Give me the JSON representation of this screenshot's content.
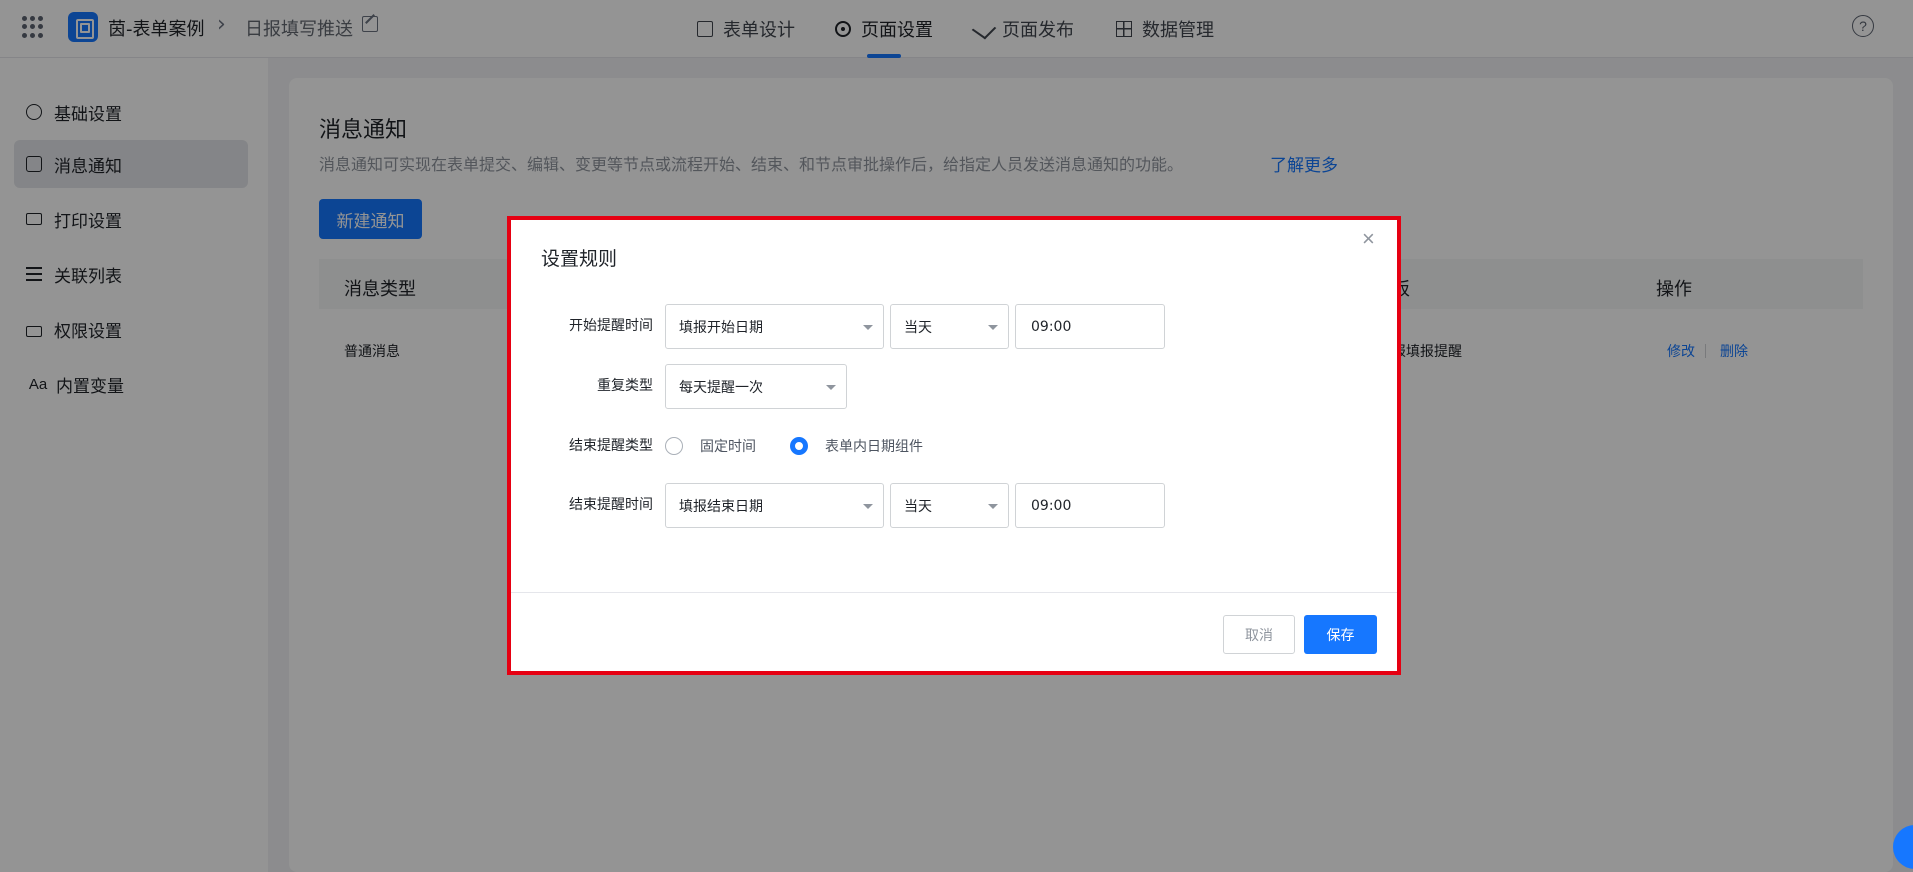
{
  "topbar": {
    "app_name": "茵-表单案例",
    "breadcrumb_sep": "›",
    "page_name": "日报填写推送",
    "tabs": [
      {
        "label": "表单设计",
        "icon": "document-icon",
        "active": false
      },
      {
        "label": "页面设置",
        "icon": "gear-icon",
        "active": true
      },
      {
        "label": "页面发布",
        "icon": "send-icon",
        "active": false
      },
      {
        "label": "数据管理",
        "icon": "grid-icon",
        "active": false
      }
    ],
    "help_glyph": "?"
  },
  "sidebar": {
    "items": [
      {
        "label": "基础设置",
        "icon": "gear-icon",
        "active": false
      },
      {
        "label": "消息通知",
        "icon": "message-icon",
        "active": true
      },
      {
        "label": "打印设置",
        "icon": "printer-icon",
        "active": false
      },
      {
        "label": "关联列表",
        "icon": "list-icon",
        "active": false
      },
      {
        "label": "权限设置",
        "icon": "lock-icon",
        "active": false
      },
      {
        "label": "内置变量",
        "icon": "font-icon",
        "glyph": "Aa",
        "active": false
      }
    ]
  },
  "main": {
    "title": "消息通知",
    "description": "消息通知可实现在表单提交、编辑、变更等节点或流程开始、结束、和节点审批操作后，给指定人员发送消息通知的功能。",
    "learn_more": "了解更多",
    "new_button": "新建通知",
    "table": {
      "headers": [
        "消息类型",
        "板",
        "操作"
      ],
      "row": {
        "type": "普通消息",
        "template": "报填报提醒",
        "actions": [
          "修改",
          "删除"
        ]
      }
    }
  },
  "modal": {
    "title": "设置规则",
    "close_glyph": "×",
    "start_time": {
      "label": "开始提醒时间",
      "date_field": "填报开始日期",
      "day": "当天",
      "time": "09:00"
    },
    "repeat": {
      "label": "重复类型",
      "value": "每天提醒一次"
    },
    "end_type": {
      "label": "结束提醒类型",
      "options": [
        "固定时间",
        "表单内日期组件"
      ],
      "selected": "表单内日期组件"
    },
    "end_time": {
      "label": "结束提醒时间",
      "date_field": "填报结束日期",
      "day": "当天",
      "time": "09:00"
    },
    "cancel": "取消",
    "save": "保存"
  },
  "colors": {
    "accent": "#1677ff",
    "highlight_border": "#e60012",
    "mask": "rgba(0,0,0,0.42)"
  }
}
